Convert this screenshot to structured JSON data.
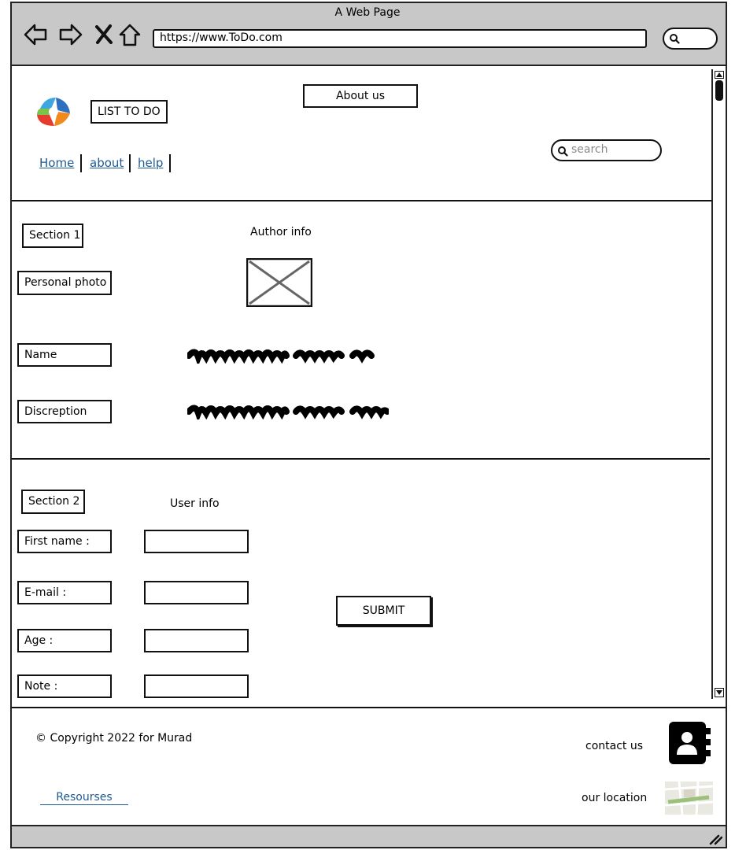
{
  "window": {
    "title": "A Web Page",
    "url": "https://www.ToDo.com"
  },
  "header": {
    "logo_label": "LIST TO DO",
    "about_button": "About us",
    "search_placeholder": "search",
    "nav": [
      "Home",
      "about",
      "help"
    ]
  },
  "section1": {
    "label": "Section 1",
    "heading": "Author info",
    "photo_label": "Personal photo",
    "name_label": "Name",
    "description_label": "Discreption"
  },
  "section2": {
    "label": "Section 2",
    "heading": "User info",
    "fields": [
      "First name :",
      "E-mail :",
      "Age :",
      "Note :"
    ],
    "submit_label": "SUBMIT"
  },
  "footer": {
    "copyright": "© Copyright 2022 for Murad",
    "resources_link": "Resourses",
    "contact_label": "contact us",
    "location_label": "our location"
  },
  "icons": [
    "back-arrow-icon",
    "forward-arrow-icon",
    "close-icon",
    "home-icon",
    "search-icon",
    "contacts-icon",
    "map-icon",
    "scroll-up-icon",
    "scroll-down-icon",
    "resize-grip-icon"
  ]
}
